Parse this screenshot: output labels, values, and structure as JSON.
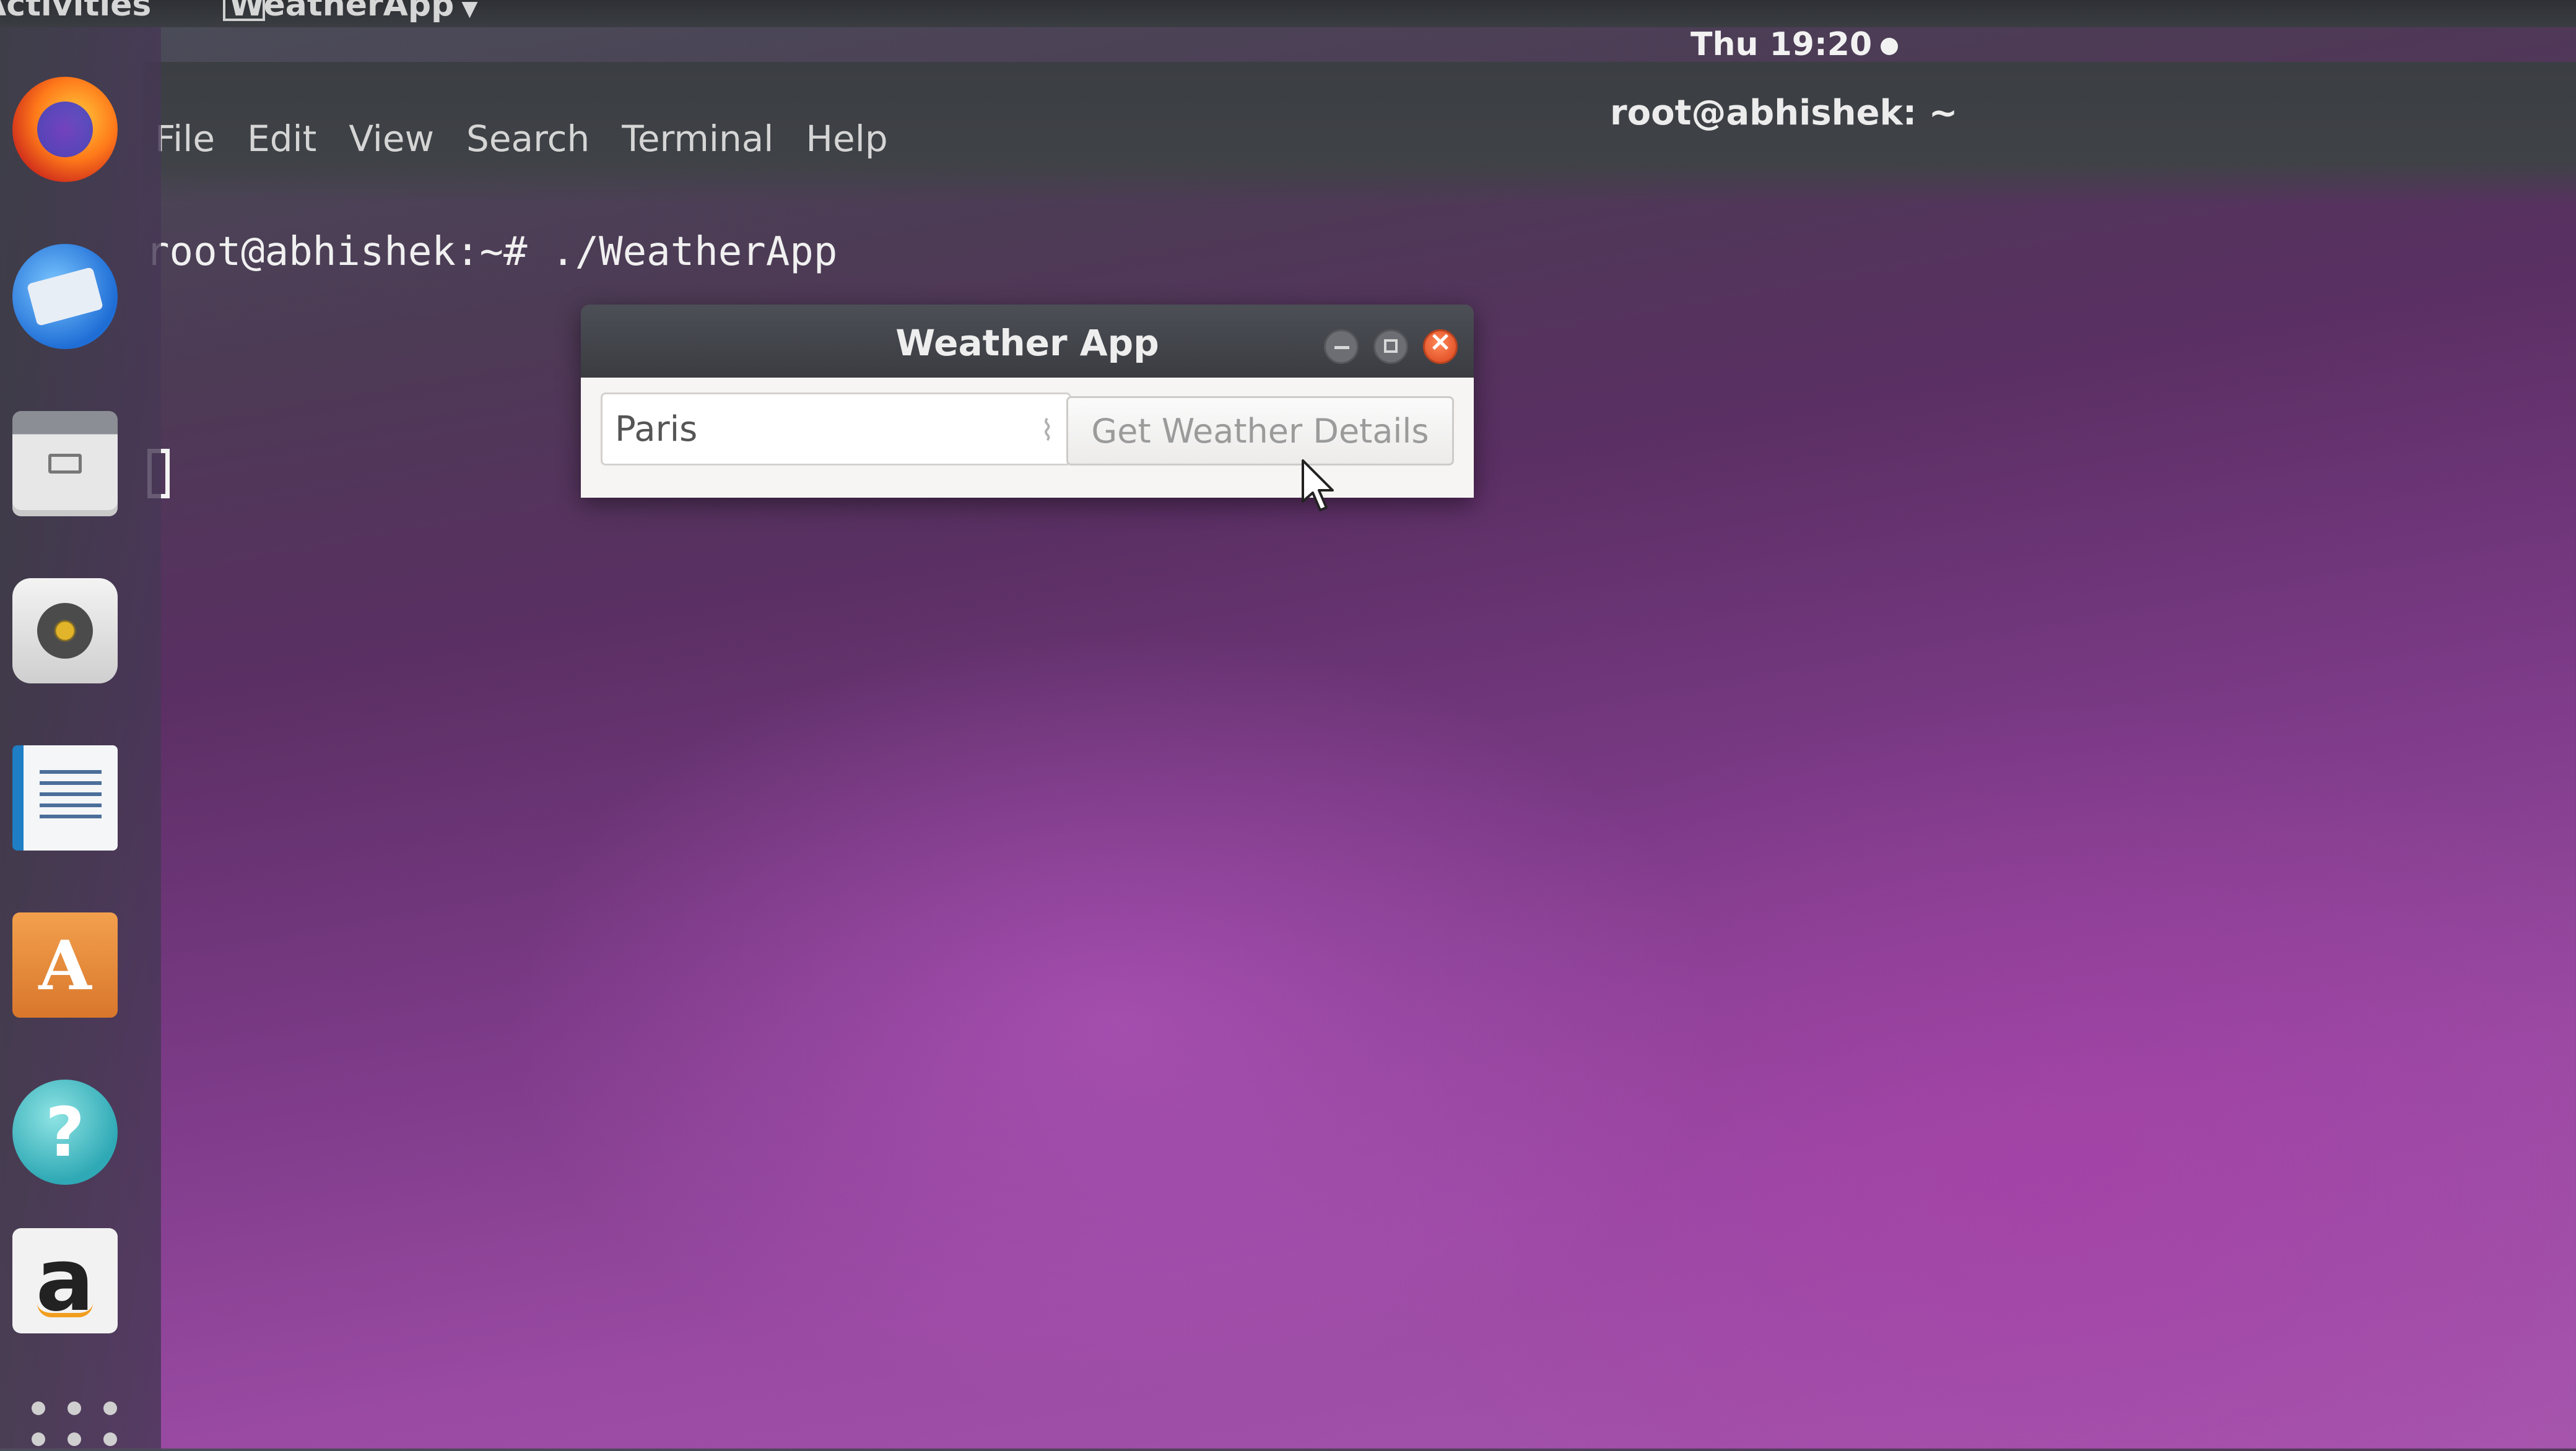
{
  "top_panel": {
    "activities": "Activities",
    "app_name": "WeatherApp",
    "clock": "Thu 19:20"
  },
  "terminal": {
    "title": "root@abhishek: ~",
    "menu": [
      "File",
      "Edit",
      "View",
      "Search",
      "Terminal",
      "Help"
    ],
    "prompt_line": "root@abhishek:~# ./WeatherApp"
  },
  "dock": {
    "icons": [
      "firefox-icon",
      "thunderbird-icon",
      "files-icon",
      "rhythmbox-icon",
      "writer-icon",
      "software-icon",
      "help-icon",
      "amazon-icon",
      "apps-grid-icon"
    ],
    "software_glyph": "A",
    "help_glyph": "?",
    "amazon_glyph": "a"
  },
  "weather_window": {
    "title": "Weather App",
    "city_value": "Paris",
    "button_label": "Get Weather Details",
    "input_marker": "⌇"
  },
  "colors": {
    "close_button": "#e5572c",
    "desktop_purple": "#9a4aa3",
    "titlebar": "#3a3c41"
  }
}
